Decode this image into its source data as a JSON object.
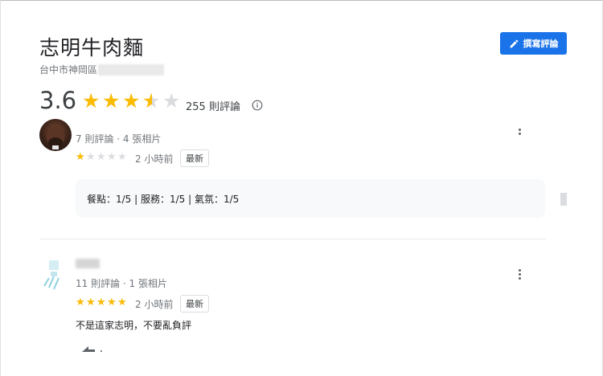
{
  "place": {
    "title": "志明牛肉麵",
    "address": "台中市神岡區"
  },
  "write_review": {
    "label": "撰寫評論",
    "icon": "pencil-icon",
    "color": "#1a73e8"
  },
  "summary": {
    "rating": "3.6",
    "rating_value": 3.6,
    "max_stars": 5,
    "review_count": "255 則評論",
    "star_color": "#fbbc04"
  },
  "reviews": [
    {
      "meta": "7 則評論 · 4 張相片",
      "stars": 1,
      "time": "2 小時前",
      "badge": "最新",
      "details": "餐點：1/5  |  服務：1/5  |  氣氛：1/5"
    },
    {
      "meta": "11 則評論 · 1 張相片",
      "stars": 5,
      "time": "2 小時前",
      "badge": "最新",
      "text": "不是這家志明，不要亂負評"
    }
  ]
}
